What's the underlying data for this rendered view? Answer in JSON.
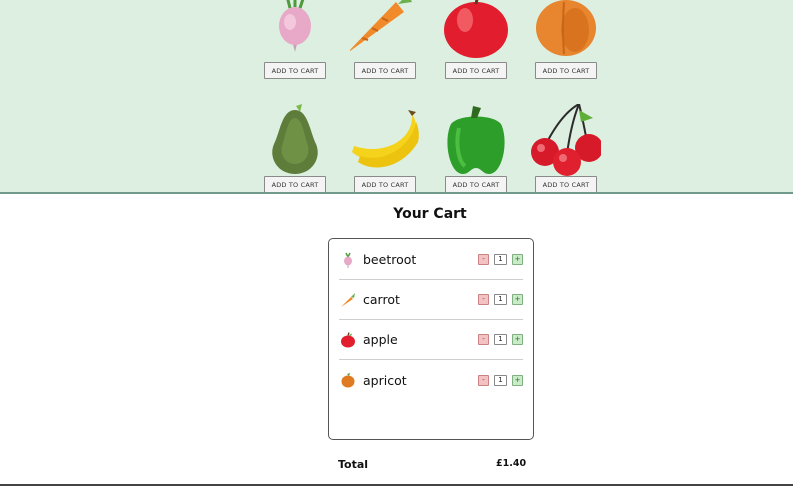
{
  "products": [
    {
      "name": "beetroot",
      "button_label": "ADD TO CART"
    },
    {
      "name": "carrot",
      "button_label": "ADD TO CART"
    },
    {
      "name": "apple",
      "button_label": "ADD TO CART"
    },
    {
      "name": "apricot",
      "button_label": "ADD TO CART"
    },
    {
      "name": "avocado",
      "button_label": "ADD TO CART"
    },
    {
      "name": "banana",
      "button_label": "ADD TO CART"
    },
    {
      "name": "pepper",
      "button_label": "ADD TO CART"
    },
    {
      "name": "cherries",
      "button_label": "ADD TO CART"
    }
  ],
  "cart": {
    "title": "Your Cart",
    "items": [
      {
        "name": "beetroot",
        "quantity": "1",
        "minus_label": "-",
        "plus_label": "+"
      },
      {
        "name": "carrot",
        "quantity": "1",
        "minus_label": "-",
        "plus_label": "+"
      },
      {
        "name": "apple",
        "quantity": "1",
        "minus_label": "-",
        "plus_label": "+"
      },
      {
        "name": "apricot",
        "quantity": "1",
        "minus_label": "-",
        "plus_label": "+"
      }
    ],
    "total_label": "Total",
    "total_value": "£1.40"
  },
  "colors": {
    "shop_background": "#dcefe0",
    "minus_button": "#f3c3c3",
    "plus_button": "#c9ebc9"
  }
}
